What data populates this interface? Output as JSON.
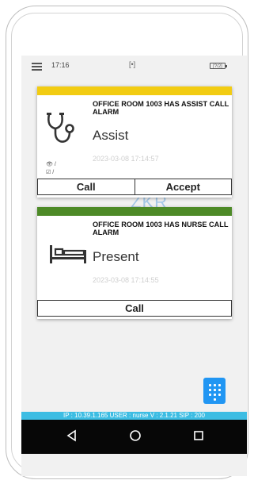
{
  "status_bar": {
    "time": "17:16",
    "signal": "[•]",
    "battery": "[?/2]"
  },
  "watermark": "ZKR",
  "cards": [
    {
      "title": "OFFICE ROOM 1003 HAS ASSIST CALL ALARM",
      "type": "Assist",
      "timestamp": "2023-03-08 17:14:57",
      "bar_color": "#f2cc12",
      "icon": "stethoscope-icon",
      "seen_mark": "/",
      "check_mark": "/",
      "buttons": [
        "Call",
        "Accept"
      ]
    },
    {
      "title": "OFFICE ROOM 1003 HAS NURSE CALL ALARM",
      "type": "Present",
      "timestamp": "2023-03-08 17:14:55",
      "bar_color": "#4d8a27",
      "icon": "bed-icon",
      "buttons": [
        "Call"
      ]
    }
  ],
  "keypad_icon": "dialpad-icon",
  "info_strip": "IP : 10.39.1.165 USER : nurse V : 2.1.21 SIP : 200",
  "nav": {
    "back": "back-icon",
    "home": "home-icon",
    "recents": "recents-icon"
  }
}
